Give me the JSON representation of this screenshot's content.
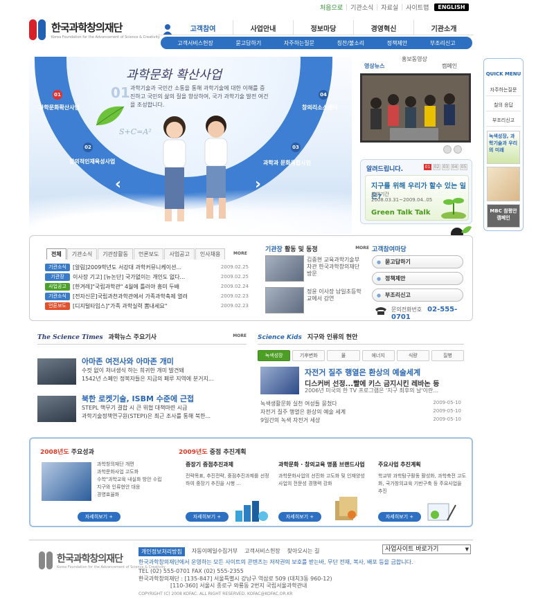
{
  "top_links": {
    "home": "처음으로",
    "intro": "기관소식",
    "data": "자료실",
    "sitemap": "사이트맵",
    "english": "ENGLISH"
  },
  "logo": {
    "name": "한국과학창의재단",
    "sub": "Korea Foundation for the Advancement of Science & Creativity"
  },
  "gnb": [
    "고객참여",
    "사업안내",
    "정보마당",
    "경영혁신",
    "기관소개"
  ],
  "subnav": [
    "고객서비스헌장",
    "묻고답하기",
    "자주하는질문",
    "칭찬/불소리",
    "정책제안",
    "부조리신고"
  ],
  "hero": {
    "title": "과학문화 확산사업",
    "num": "01",
    "desc": "과학기술과 국민간 소통을 통해 과학기술에 대한 이해를 증진하고 국민의 삶의 질을 향상하여, 국가 과학기술 발전 여건을 조성합니다.",
    "items": [
      {
        "n": "01",
        "label": "과학문화확산사업"
      },
      {
        "n": "02",
        "label": "창의적인재육성사업"
      },
      {
        "n": "03",
        "label": "과학과 문화융합사업"
      },
      {
        "n": "04",
        "label": "창의리소스센터"
      }
    ],
    "formula": "S+C=A²",
    "prev": "‹",
    "next": "›"
  },
  "media": {
    "tabs": [
      "영상뉴스",
      "홍보동영상",
      "캠페인"
    ]
  },
  "notice": {
    "title": "알려드립니다.",
    "pages": [
      "01",
      "02",
      "03",
      "04",
      "05"
    ],
    "question": "지구를 위해 우리가 할수 있는 일은?",
    "period_label": "참여기간",
    "period": "2008.03.31~2009.04..05",
    "brand": "Green Talk Talk"
  },
  "quick": {
    "title": "QUICK MENU",
    "items": [
      "자주하는질문",
      "칠의 응답",
      "부조리신고"
    ],
    "banner1": "녹색성장, 과학기술과 우리의 미래",
    "banner2": "MBC 참평안 캠페인"
  },
  "board": {
    "tabs": [
      "전체",
      "기관소식",
      "기관장활동",
      "언론보도",
      "사업공고",
      "인사채용"
    ],
    "more": "MORE",
    "rows": [
      {
        "tag": "기관소식",
        "color": "#3b7cc9",
        "text": "[알림]2009학년도 서강대 과학커뮤니케이션...",
        "date": "2009.02.25"
      },
      {
        "tag": "기관장",
        "color": "#3b7cc9",
        "text": "이사장 기고] [뉴논단] 국가없이는 개인도 없다...",
        "date": "2009.02.25"
      },
      {
        "tag": "사업공고",
        "color": "#4aa02a",
        "text": "[한겨레]\"국립과학관\" 4월에 틀러야 흥미 두배",
        "date": "2009.02.24"
      },
      {
        "tag": "기관소식",
        "color": "#3b7cc9",
        "text": "[전자신문]국립과천과학관에서 가족과학축제 열려",
        "date": "2009.02.23"
      },
      {
        "tag": "언론보도",
        "color": "#e2512e",
        "text": "[디지털타임스]\"가족 과학실력 뽐내세요\"",
        "date": "2009.02.23"
      }
    ]
  },
  "ceo": {
    "title_em": "기관장",
    "title": "활동 및 동정",
    "more": "MORE",
    "items": [
      "김중현 교육과학기술부 차관 한국과학창의재단 방문",
      "정윤 이사장 남일초등학교에서 강연"
    ]
  },
  "customer": {
    "title": "고객참여마당",
    "buttons": [
      "묻고답하기",
      "정책제안",
      "부조리신고"
    ],
    "phone_label": "문의전화번호",
    "phone": "02-555-0701"
  },
  "science": {
    "logo": "The Science Times",
    "title": "과학뉴스 주요기사",
    "more": "MORE",
    "articles": [
      {
        "title": "아마존 여전사와 아마존 개미",
        "line1": "수컷 없이 처녀생식 하는 희귀한 개미 발견돼",
        "line2": "1542년 스페인 정복자들은 지금의 페루 지역에 분거지..."
      },
      {
        "title": "북한 로켓기술, ISBM 수준에 근접",
        "line1": "STEPL 핵무기 결합 시 큰 위협 대책마련 시급",
        "line2": "과학기술정책연구원(STEPI)은 최근 조사를 통해 북한..."
      }
    ]
  },
  "earth": {
    "logo": "Science Kids",
    "title": "지구와 인류의 현안",
    "tabs": [
      "녹색성장",
      "기후변화",
      "물",
      "에너지",
      "식량",
      "질병"
    ],
    "headline": "자전거 질주 행열은 환상의 예술세계",
    "sub": "디스커버 선정...빨에 키스 금지시킨 레바논 등",
    "desc": "2006년 미국의 한 TV 프로그램은 '지구 최후의 날'이란...",
    "rows": [
      {
        "text": "녹색생활문화 실천 여성들 뭉쳤다",
        "date": "2009-05-10"
      },
      {
        "text": "자전거 질주 행열은 환상의 예술 세계",
        "date": "2009-05-10"
      },
      {
        "text": "9일간의 녹색 자전거 세상",
        "date": "2009-05-10"
      }
    ]
  },
  "achievements": {
    "h1_em": "2008년도",
    "h1": "주요성과",
    "h2_em": "2009년도",
    "h2": "중점 추진계획",
    "col1": [
      "과학창의재단 개편",
      "과학문화사업 고도화",
      "수학\"과학교육 내실화 방안 수립",
      "지구와 인류현안 대응",
      "경영효율화"
    ],
    "cols": [
      {
        "title": "중장기 중점추진과제",
        "desc": "전략목표, 추진전략, 중점추진과제를 선정하여 중장기 추진을 시행 ..."
      },
      {
        "title": "과학문화 · 창의교육 명품 브랜드사업",
        "desc": "과학문화사업의 선진화 고도화 및 인재양성사업의 전문성 경쟁력 강화"
      },
      {
        "title": "주요사업 추진계획",
        "desc": "학교밖 과학탐구활동 활성화, 과학축전 고도화, 국가창의교육 기반구축 등 주요사업을 추진"
      }
    ],
    "more": "자세히보기 +"
  },
  "footer": {
    "links": [
      "개인정보처리방침",
      "자동이메일수집거부",
      "고객서비스헌장",
      "찾아오시는 길"
    ],
    "select": "사업사이트 바로가기",
    "notice": "한국과학창의재단에서 운영하는 모든 사이트의 콘텐츠는 저작권의 보호를 받는바, 무단 전재, 복사, 배포 등을 금합니다.",
    "tel": "TEL (02) 555-0701 FAX (02) 555-2355",
    "addr1": "한국과학창의재단 : [135-847] 서울특별시 강남구 역삼로 509 (대치3동 960-12)",
    "addr2": "[110-360] 서울시 종로구 와룡동 2번지 국립서울과학관내",
    "copy": "COPYRIGHT (C) 2008 KOFAC. ALL RIGHT RESERVED. KOFAC@KOFAC.OR.KR"
  }
}
